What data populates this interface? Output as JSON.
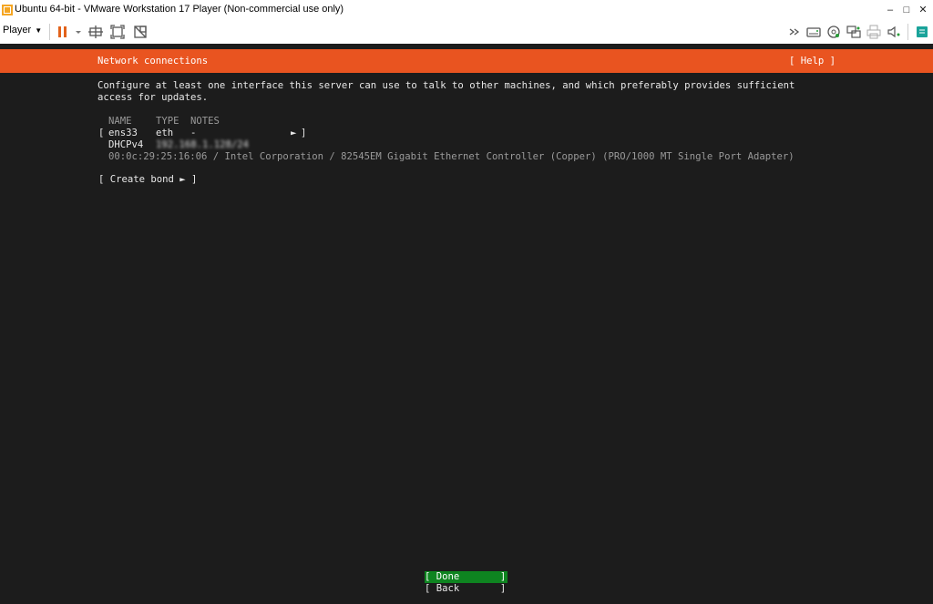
{
  "window": {
    "title": "Ubuntu 64-bit - VMware Workstation 17 Player (Non-commercial use only)",
    "minimize": "–",
    "maximize": "□",
    "close": "✕"
  },
  "toolbar": {
    "player_label": "Player",
    "player_caret": "▼",
    "icons": [
      "pause-icon",
      "send-ctrl-alt-del-icon",
      "full-screen-icon",
      "unity-icon",
      "message-log-icon",
      "removable-devices-icon",
      "network-adapter-icon",
      "usb-icon",
      "printer-icon",
      "sound-icon",
      "notes-icon"
    ]
  },
  "installer": {
    "header_title": "Network connections",
    "help_label": "[ Help ]",
    "intro_line1": "Configure at least one interface this server can use to talk to other machines, and which preferably provides sufficient",
    "intro_line2": "access for updates.",
    "columns": {
      "name": "NAME",
      "type": "TYPE",
      "notes": "NOTES"
    },
    "interface": {
      "open_bracket": "[",
      "name": "ens33",
      "type": "eth",
      "notes": "-",
      "arrow": "►",
      "close_bracket": "]",
      "dhcp_label": "DHCPv4",
      "dhcp_value": "192.168.1.128/24",
      "hardware": "00:0c:29:25:16:06 / Intel Corporation / 82545EM Gigabit Ethernet Controller (Copper) (PRO/1000 MT Single Port Adapter)"
    },
    "create_bond": "[ Create bond ► ]",
    "done_label": "[ Done       ]",
    "back_label": "[ Back       ]"
  },
  "colors": {
    "accent_orange": "#e95420",
    "terminal_bg": "#1c1c1c",
    "done_green": "#0e8420"
  }
}
